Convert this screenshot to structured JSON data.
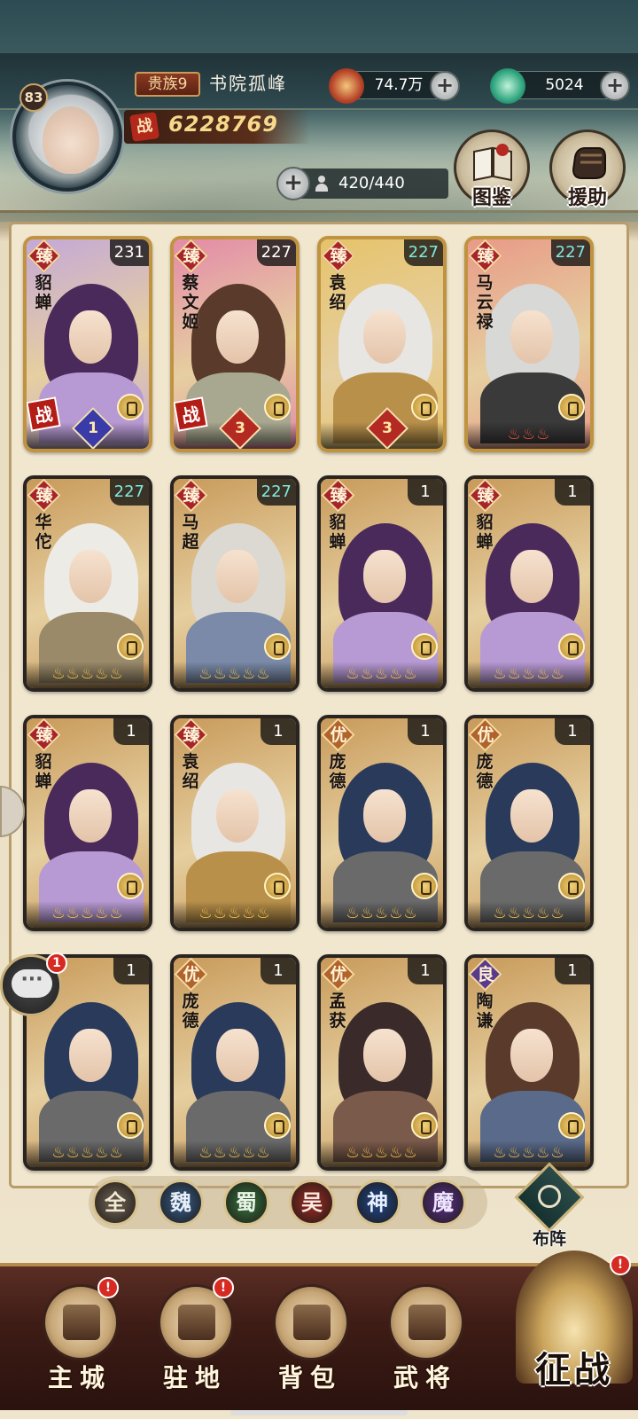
{
  "header": {
    "level": "83",
    "noble_rank": "贵族9",
    "player_name": "书院孤峰",
    "power_icon": "战",
    "power": "6228769",
    "silver": {
      "icon": "coin-icon",
      "value": "74.7万"
    },
    "jade": {
      "icon": "jade-icon",
      "value": "5024"
    },
    "capacity": "420/440",
    "codex_label": "图鉴",
    "assist_label": "援助"
  },
  "cards": [
    {
      "grade": "臻",
      "name": "貂蝉",
      "level": "231",
      "level_color": "white",
      "role": "leaf",
      "flames": "",
      "war": "战",
      "star": "1",
      "bg": "#c4a8d8",
      "hair": "#4a2a5a",
      "body": "#b79ad3"
    },
    {
      "grade": "臻",
      "name": "蔡文姬",
      "level": "227",
      "level_color": "white",
      "role": "staff",
      "flames": "",
      "war": "战",
      "star": "3",
      "bg": "#e48aa8",
      "hair": "#5a3a2a",
      "body": "#a8a890"
    },
    {
      "grade": "臻",
      "name": "袁绍",
      "level": "227",
      "level_color": "teal",
      "role": "staff",
      "flames": "",
      "war": "",
      "star": "3",
      "bg": "#e6c36a",
      "hair": "#e8e6e2",
      "body": "#b8904a"
    },
    {
      "grade": "臻",
      "name": "马云禄",
      "level": "227",
      "level_color": "teal",
      "role": "shield",
      "flames": "♨♨♨",
      "war": "",
      "star": "",
      "bg": "#e89a88",
      "hair": "#d8d8d6",
      "body": "#3a3a3a"
    },
    {
      "grade": "臻",
      "name": "华佗",
      "level": "227",
      "level_color": "teal",
      "role": "leaf",
      "flames": "♨♨♨♨♨",
      "war": "",
      "star": "",
      "bg": "#c89a5a",
      "hair": "#ecebe6",
      "body": "#9a8a6a"
    },
    {
      "grade": "臻",
      "name": "马超",
      "level": "227",
      "level_color": "teal",
      "role": "sword",
      "flames": "♨♨♨♨♨",
      "war": "",
      "star": "",
      "bg": "#c89a5a",
      "hair": "#dcd8d2",
      "body": "#7a8aa8"
    },
    {
      "grade": "臻",
      "name": "貂蝉",
      "level": "1",
      "level_color": "white",
      "role": "leaf",
      "flames": "♨♨♨♨♨",
      "war": "",
      "star": "",
      "bg": "#c89a5a",
      "hair": "#4a2a5a",
      "body": "#b79ad3"
    },
    {
      "grade": "臻",
      "name": "貂蝉",
      "level": "1",
      "level_color": "white",
      "role": "leaf",
      "flames": "♨♨♨♨♨",
      "war": "",
      "star": "",
      "bg": "#c89a5a",
      "hair": "#4a2a5a",
      "body": "#b79ad3"
    },
    {
      "grade": "臻",
      "name": "貂蝉",
      "level": "1",
      "level_color": "white",
      "role": "leaf",
      "flames": "♨♨♨♨♨",
      "war": "",
      "star": "",
      "bg": "#c89a5a",
      "hair": "#4a2a5a",
      "body": "#b79ad3"
    },
    {
      "grade": "臻",
      "name": "袁绍",
      "level": "1",
      "level_color": "white",
      "role": "staff",
      "flames": "♨♨♨♨♨",
      "war": "",
      "star": "",
      "bg": "#c89a5a",
      "hair": "#e8e6e2",
      "body": "#b8904a"
    },
    {
      "grade": "优",
      "name": "庞德",
      "level": "1",
      "level_color": "white",
      "role": "shield",
      "flames": "♨♨♨♨♨",
      "war": "",
      "star": "",
      "bg": "#c89a5a",
      "hair": "#2a3a5a",
      "body": "#6a6a6a"
    },
    {
      "grade": "优",
      "name": "庞德",
      "level": "1",
      "level_color": "white",
      "role": "shield",
      "flames": "♨♨♨♨♨",
      "war": "",
      "star": "",
      "bg": "#c89a5a",
      "hair": "#2a3a5a",
      "body": "#6a6a6a"
    },
    {
      "grade": "优",
      "name": "德",
      "level": "1",
      "level_color": "white",
      "role": "shield",
      "flames": "♨♨♨♨♨",
      "war": "",
      "star": "",
      "bg": "#c89a5a",
      "hair": "#2a3a5a",
      "body": "#6a6a6a"
    },
    {
      "grade": "优",
      "name": "庞德",
      "level": "1",
      "level_color": "white",
      "role": "shield",
      "flames": "♨♨♨♨♨",
      "war": "",
      "star": "",
      "bg": "#c89a5a",
      "hair": "#2a3a5a",
      "body": "#6a6a6a"
    },
    {
      "grade": "优",
      "name": "孟获",
      "level": "1",
      "level_color": "white",
      "role": "sword",
      "flames": "♨♨♨♨♨",
      "war": "",
      "star": "",
      "bg": "#c89a5a",
      "hair": "#3a2a2a",
      "body": "#7a5a4a"
    },
    {
      "grade": "良",
      "name": "陶谦",
      "level": "1",
      "level_color": "white",
      "role": "sword",
      "flames": "♨♨♨♨♨",
      "war": "",
      "star": "",
      "bg": "#c89a5a",
      "hair": "#5a3a2a",
      "body": "#5a6a8a"
    }
  ],
  "grade_colors": {
    "臻": "#a6242a",
    "优": "#b0632a",
    "良": "#5a3a8a"
  },
  "factions": [
    {
      "label": "全",
      "color": "#5a5044",
      "text": "#f2ead4"
    },
    {
      "label": "魏",
      "color": "#2e4a6a",
      "text": "#e6eef8"
    },
    {
      "label": "蜀",
      "color": "#2e5a32",
      "text": "#eaf4e6"
    },
    {
      "label": "吴",
      "color": "#7a2620",
      "text": "#fbe8e0"
    },
    {
      "label": "神",
      "color": "#1e3a6a",
      "text": "#e8f0ff"
    },
    {
      "label": "魔",
      "color": "#4a2a6a",
      "text": "#f0e6ff"
    }
  ],
  "formation_label": "布阵",
  "chat": {
    "badge": "1"
  },
  "nav": [
    {
      "label": "主城",
      "badge": "!"
    },
    {
      "label": "驻地",
      "badge": "!"
    },
    {
      "label": "背包",
      "badge": ""
    },
    {
      "label": "武将",
      "badge": ""
    }
  ],
  "battle": {
    "label": "征战",
    "badge": "!"
  }
}
